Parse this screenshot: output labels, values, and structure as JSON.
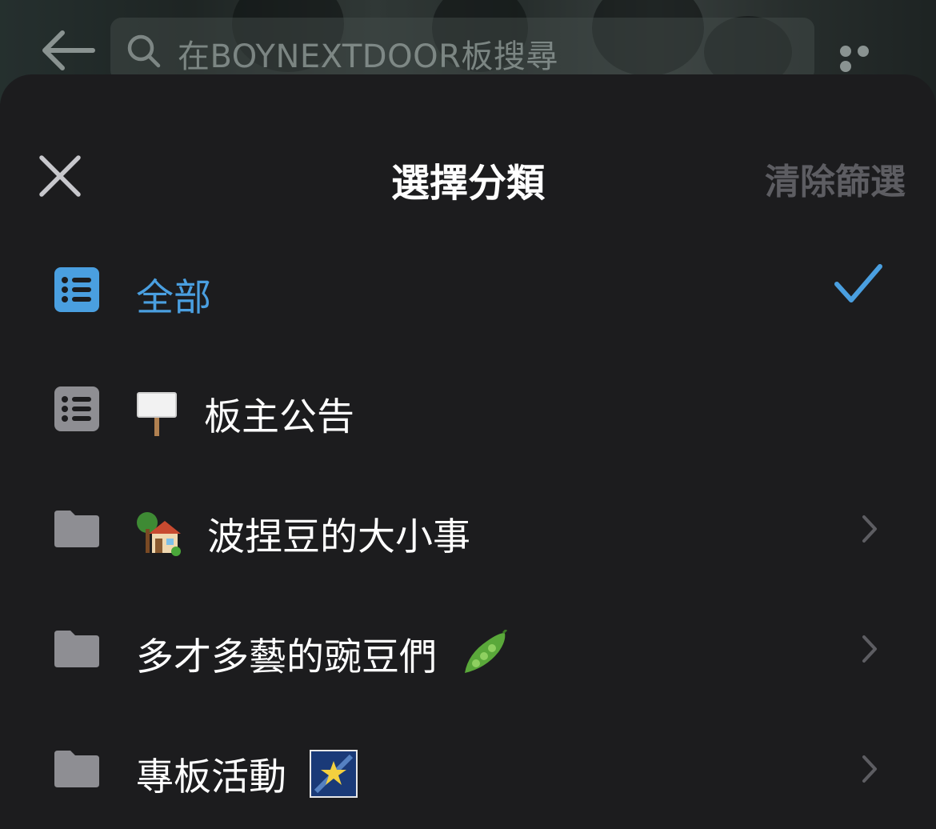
{
  "header": {
    "search_placeholder": "在BOYNEXTDOOR板搜尋",
    "icons": [
      "back-arrow-icon",
      "search-icon",
      "more-icon"
    ]
  },
  "sheet": {
    "title": "選擇分類",
    "clear_label": "清除篩選",
    "close_icon": "close-icon"
  },
  "categories": [
    {
      "label": "全部",
      "icon": "list-icon",
      "selected": true,
      "accent": "#4a9fe0"
    },
    {
      "label": "板主公告",
      "emoji": "🪧",
      "icon": "list-icon",
      "selected": false
    },
    {
      "label": "波捏豆的大小事",
      "emoji": "🏡",
      "icon": "folder-icon",
      "has_children": true
    },
    {
      "label": "多才多藝的豌豆們",
      "emoji": "🫛",
      "icon": "folder-icon",
      "has_children": true
    },
    {
      "label": "專板活動",
      "emoji": "🌠",
      "icon": "folder-icon",
      "has_children": true
    }
  ],
  "colors": {
    "background": "#1c1c1e",
    "accent": "#4a9fe0",
    "text": "#ffffff",
    "muted": "#5d5d62",
    "icon_gray": "#8e8e93"
  }
}
